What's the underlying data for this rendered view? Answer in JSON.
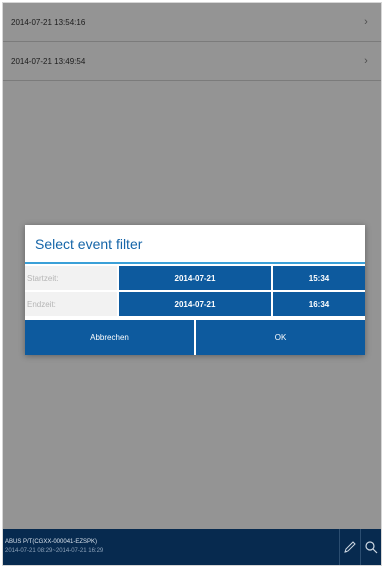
{
  "events": [
    {
      "timestamp": "2014-07-21 13:54:16"
    },
    {
      "timestamp": "2014-07-21 13:49:54"
    }
  ],
  "dialog": {
    "title": "Select event filter",
    "start_label": "Startzeit:",
    "start_date": "2014-07-21",
    "start_time": "15:34",
    "end_label": "Endzeit:",
    "end_date": "2014-07-21",
    "end_time": "16:34",
    "cancel_label": "Abbrechen",
    "ok_label": "OK"
  },
  "bottombar": {
    "device": "ABUS P/T(CGXX-000041-EZSPK)",
    "range": "2014-07-21 08:29~2014-07-21 16:29"
  },
  "colors": {
    "accent": "#0d5a9e",
    "title": "#1565a8",
    "bar": "#072a4f"
  },
  "icons": [
    "chevron-right-icon",
    "pencil-icon",
    "search-icon"
  ]
}
